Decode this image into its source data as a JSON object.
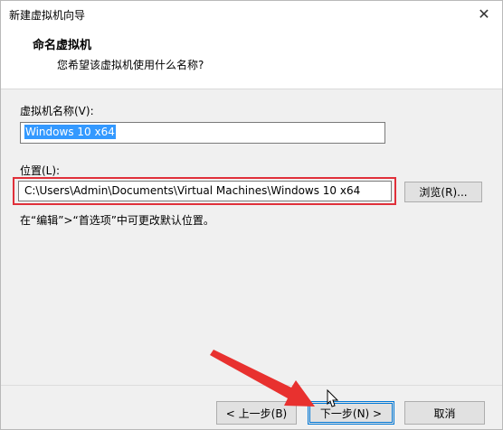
{
  "window": {
    "title": "新建虚拟机向导",
    "close_glyph": "✕"
  },
  "header": {
    "title": "命名虚拟机",
    "subtitle": "您希望该虚拟机使用什么名称?"
  },
  "form": {
    "name_label": "虚拟机名称(V):",
    "name_value": "Windows 10 x64",
    "location_label": "位置(L):",
    "location_value": "C:\\Users\\Admin\\Documents\\Virtual Machines\\Windows 10 x64",
    "browse_label": "浏览(R)...",
    "hint": "在“编辑”>“首选项”中可更改默认位置。"
  },
  "footer": {
    "back_label": "< 上一步(B)",
    "next_label": "下一步(N) >",
    "cancel_label": "取消"
  },
  "annotations": {
    "highlight_color": "#e0303a",
    "arrow_color": "#e8312f",
    "pointer_icon": "mouse-pointer-icon"
  }
}
